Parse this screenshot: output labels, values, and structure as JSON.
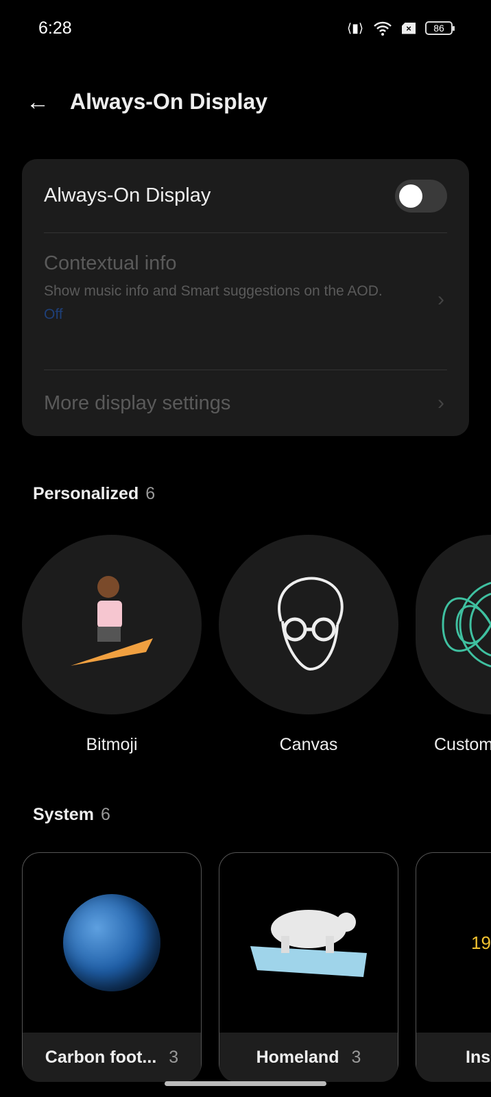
{
  "status": {
    "time": "6:28",
    "battery": "86",
    "icons": [
      "vibrate-icon",
      "wifi-icon",
      "no-sim-icon",
      "battery-icon"
    ]
  },
  "header": {
    "title": "Always-On Display"
  },
  "settings": {
    "aod_label": "Always-On Display",
    "aod_on": false,
    "contextual_label": "Contextual info",
    "contextual_desc": "Show music info and Smart suggestions on the AOD.",
    "contextual_value": "Off",
    "more_label": "More display settings"
  },
  "personalized": {
    "title": "Personalized",
    "count": "6",
    "items": [
      {
        "label": "Bitmoji"
      },
      {
        "label": "Canvas"
      },
      {
        "label": "Custom"
      }
    ]
  },
  "system": {
    "title": "System",
    "count": "6",
    "items": [
      {
        "label": "Carbon foot...",
        "count": "3"
      },
      {
        "label": "Homeland",
        "count": "3"
      },
      {
        "label": "Ins",
        "count": "",
        "preview": "19"
      }
    ]
  },
  "colors": {
    "accent": "#1e3f78",
    "clock_yellow": "#f2c230"
  }
}
